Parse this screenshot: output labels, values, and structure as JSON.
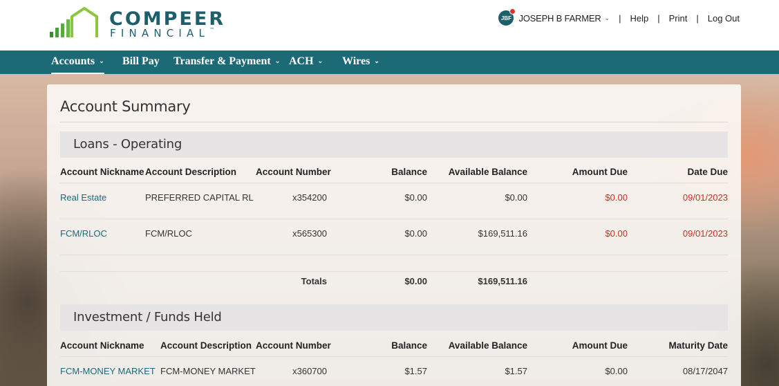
{
  "brand": {
    "name_line1": "COMPEER",
    "name_line2": "FINANCIAL",
    "trademark": "™",
    "accent": "#1d6a77"
  },
  "user": {
    "initials": "JBF",
    "name": "JOSEPH B FARMER"
  },
  "top_links": {
    "help": "Help",
    "print": "Print",
    "logout": "Log Out"
  },
  "nav": [
    {
      "label": "Accounts",
      "active": true,
      "has_menu": true
    },
    {
      "label": "Bill Pay",
      "active": false,
      "has_menu": false
    },
    {
      "label": "Transfer & Payment",
      "active": false,
      "has_menu": true
    },
    {
      "label": "ACH",
      "active": false,
      "has_menu": true
    },
    {
      "label": "Wires",
      "active": false,
      "has_menu": true
    }
  ],
  "page_title": "Account Summary",
  "loans": {
    "title": "Loans - Operating",
    "headers": [
      "Account Nickname",
      "Account Description",
      "Account Number",
      "Balance",
      "Available Balance",
      "Amount Due",
      "Date Due"
    ],
    "rows": [
      {
        "nickname": "Real Estate",
        "description": "PREFERRED CAPITAL RL",
        "number": "x354200",
        "balance": "$0.00",
        "available": "$0.00",
        "due": "$0.00",
        "date_due": "09/01/2023"
      },
      {
        "nickname": "FCM/RLOC",
        "description": "FCM/RLOC",
        "number": "x565300",
        "balance": "$0.00",
        "available": "$169,511.16",
        "due": "$0.00",
        "date_due": "09/01/2023"
      }
    ],
    "totals": {
      "label": "Totals",
      "balance": "$0.00",
      "available": "$169,511.16"
    }
  },
  "investment": {
    "title": "Investment / Funds Held",
    "headers": [
      "Account Nickname",
      "Account Description",
      "Account Number",
      "Balance",
      "Available Balance",
      "Amount Due",
      "Maturity Date"
    ],
    "rows": [
      {
        "nickname": "FCM-MONEY MARKET",
        "description": "FCM-MONEY MARKET",
        "number": "x360700",
        "balance": "$1.57",
        "available": "$1.57",
        "due": "$0.00",
        "maturity": "08/17/2047"
      }
    ]
  }
}
